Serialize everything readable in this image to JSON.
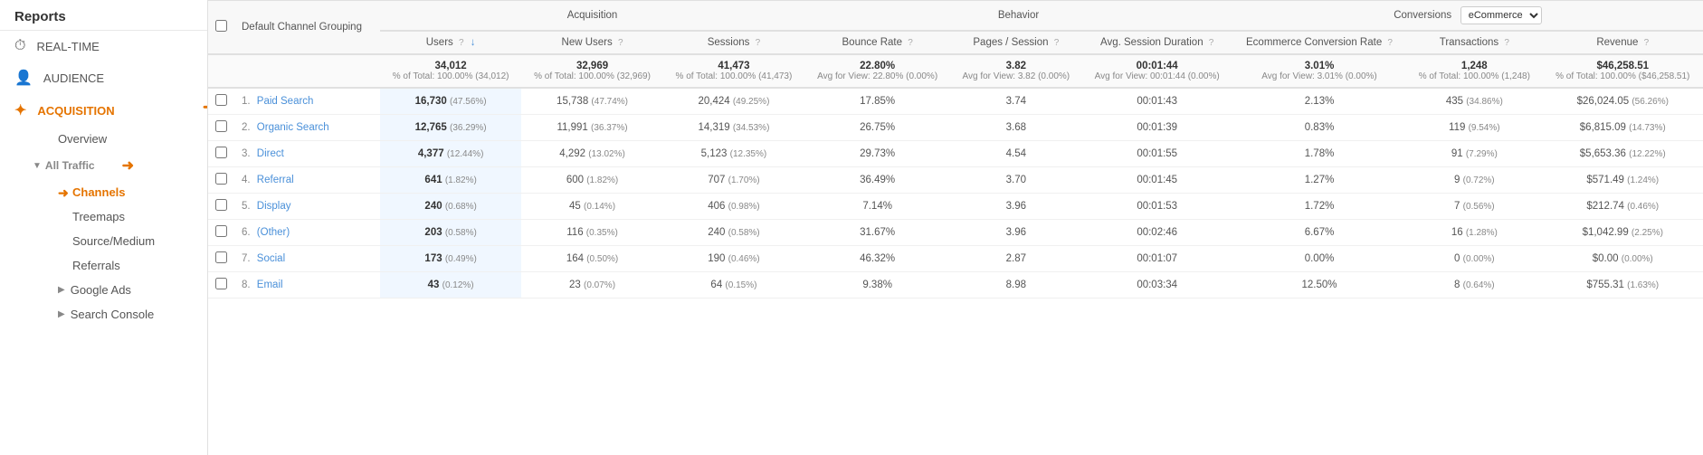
{
  "sidebar": {
    "title": "Reports",
    "items": [
      {
        "id": "realtime",
        "label": "REAL-TIME",
        "icon": "⏱"
      },
      {
        "id": "audience",
        "label": "AUDIENCE",
        "icon": "👤"
      },
      {
        "id": "acquisition",
        "label": "ACQUISITION",
        "icon": "✦",
        "active": true
      }
    ],
    "sub_items": [
      {
        "id": "overview",
        "label": "Overview"
      },
      {
        "id": "all-traffic",
        "label": "All Traffic",
        "has_arrow": true,
        "expanded": true
      },
      {
        "id": "channels",
        "label": "Channels",
        "active": true
      },
      {
        "id": "treemaps",
        "label": "Treemaps"
      },
      {
        "id": "source-medium",
        "label": "Source/Medium"
      },
      {
        "id": "referrals",
        "label": "Referrals"
      },
      {
        "id": "google-ads",
        "label": "Google Ads",
        "has_arrow": true
      },
      {
        "id": "search-console",
        "label": "Search Console",
        "has_arrow": true
      }
    ]
  },
  "table": {
    "channel_col": "Default Channel Grouping",
    "acquisition_label": "Acquisition",
    "behavior_label": "Behavior",
    "conversions_label": "Conversions",
    "conversions_option": "eCommerce",
    "columns": [
      {
        "id": "users",
        "label": "Users",
        "has_sort": true
      },
      {
        "id": "new-users",
        "label": "New Users"
      },
      {
        "id": "sessions",
        "label": "Sessions"
      },
      {
        "id": "bounce-rate",
        "label": "Bounce Rate"
      },
      {
        "id": "pages-session",
        "label": "Pages / Session"
      },
      {
        "id": "avg-session",
        "label": "Avg. Session Duration"
      },
      {
        "id": "ecommerce-rate",
        "label": "Ecommerce Conversion Rate"
      },
      {
        "id": "transactions",
        "label": "Transactions"
      },
      {
        "id": "revenue",
        "label": "Revenue"
      }
    ],
    "totals": {
      "users": "34,012",
      "users_sub": "% of Total: 100.00% (34,012)",
      "new_users": "32,969",
      "new_users_sub": "% of Total: 100.00% (32,969)",
      "sessions": "41,473",
      "sessions_sub": "% of Total: 100.00% (41,473)",
      "bounce_rate": "22.80%",
      "bounce_rate_sub": "Avg for View: 22.80% (0.00%)",
      "pages_session": "3.82",
      "pages_session_sub": "Avg for View: 3.82 (0.00%)",
      "avg_session": "00:01:44",
      "avg_session_sub": "Avg for View: 00:01:44 (0.00%)",
      "ecommerce_rate": "3.01%",
      "ecommerce_rate_sub": "Avg for View: 3.01% (0.00%)",
      "transactions": "1,248",
      "transactions_sub": "% of Total: 100.00% (1,248)",
      "revenue": "$46,258.51",
      "revenue_sub": "% of Total: 100.00% ($46,258.51)"
    },
    "rows": [
      {
        "num": "1.",
        "channel": "Paid Search",
        "users": "16,730",
        "users_pct": "(47.56%)",
        "new_users": "15,738",
        "new_users_pct": "(47.74%)",
        "sessions": "20,424",
        "sessions_pct": "(49.25%)",
        "bounce_rate": "17.85%",
        "pages_session": "3.74",
        "avg_session": "00:01:43",
        "ecommerce_rate": "2.13%",
        "transactions": "435",
        "transactions_pct": "(34.86%)",
        "revenue": "$26,024.05",
        "revenue_pct": "(56.26%)"
      },
      {
        "num": "2.",
        "channel": "Organic Search",
        "users": "12,765",
        "users_pct": "(36.29%)",
        "new_users": "11,991",
        "new_users_pct": "(36.37%)",
        "sessions": "14,319",
        "sessions_pct": "(34.53%)",
        "bounce_rate": "26.75%",
        "pages_session": "3.68",
        "avg_session": "00:01:39",
        "ecommerce_rate": "0.83%",
        "transactions": "119",
        "transactions_pct": "(9.54%)",
        "revenue": "$6,815.09",
        "revenue_pct": "(14.73%)"
      },
      {
        "num": "3.",
        "channel": "Direct",
        "users": "4,377",
        "users_pct": "(12.44%)",
        "new_users": "4,292",
        "new_users_pct": "(13.02%)",
        "sessions": "5,123",
        "sessions_pct": "(12.35%)",
        "bounce_rate": "29.73%",
        "pages_session": "4.54",
        "avg_session": "00:01:55",
        "ecommerce_rate": "1.78%",
        "transactions": "91",
        "transactions_pct": "(7.29%)",
        "revenue": "$5,653.36",
        "revenue_pct": "(12.22%)"
      },
      {
        "num": "4.",
        "channel": "Referral",
        "users": "641",
        "users_pct": "(1.82%)",
        "new_users": "600",
        "new_users_pct": "(1.82%)",
        "sessions": "707",
        "sessions_pct": "(1.70%)",
        "bounce_rate": "36.49%",
        "pages_session": "3.70",
        "avg_session": "00:01:45",
        "ecommerce_rate": "1.27%",
        "transactions": "9",
        "transactions_pct": "(0.72%)",
        "revenue": "$571.49",
        "revenue_pct": "(1.24%)"
      },
      {
        "num": "5.",
        "channel": "Display",
        "users": "240",
        "users_pct": "(0.68%)",
        "new_users": "45",
        "new_users_pct": "(0.14%)",
        "sessions": "406",
        "sessions_pct": "(0.98%)",
        "bounce_rate": "7.14%",
        "pages_session": "3.96",
        "avg_session": "00:01:53",
        "ecommerce_rate": "1.72%",
        "transactions": "7",
        "transactions_pct": "(0.56%)",
        "revenue": "$212.74",
        "revenue_pct": "(0.46%)"
      },
      {
        "num": "6.",
        "channel": "(Other)",
        "users": "203",
        "users_pct": "(0.58%)",
        "new_users": "116",
        "new_users_pct": "(0.35%)",
        "sessions": "240",
        "sessions_pct": "(0.58%)",
        "bounce_rate": "31.67%",
        "pages_session": "3.96",
        "avg_session": "00:02:46",
        "ecommerce_rate": "6.67%",
        "transactions": "16",
        "transactions_pct": "(1.28%)",
        "revenue": "$1,042.99",
        "revenue_pct": "(2.25%)"
      },
      {
        "num": "7.",
        "channel": "Social",
        "users": "173",
        "users_pct": "(0.49%)",
        "new_users": "164",
        "new_users_pct": "(0.50%)",
        "sessions": "190",
        "sessions_pct": "(0.46%)",
        "bounce_rate": "46.32%",
        "pages_session": "2.87",
        "avg_session": "00:01:07",
        "ecommerce_rate": "0.00%",
        "transactions": "0",
        "transactions_pct": "(0.00%)",
        "revenue": "$0.00",
        "revenue_pct": "(0.00%)"
      },
      {
        "num": "8.",
        "channel": "Email",
        "users": "43",
        "users_pct": "(0.12%)",
        "new_users": "23",
        "new_users_pct": "(0.07%)",
        "sessions": "64",
        "sessions_pct": "(0.15%)",
        "bounce_rate": "9.38%",
        "pages_session": "8.98",
        "avg_session": "00:03:34",
        "ecommerce_rate": "12.50%",
        "transactions": "8",
        "transactions_pct": "(0.64%)",
        "revenue": "$755.31",
        "revenue_pct": "(1.63%)"
      }
    ]
  }
}
